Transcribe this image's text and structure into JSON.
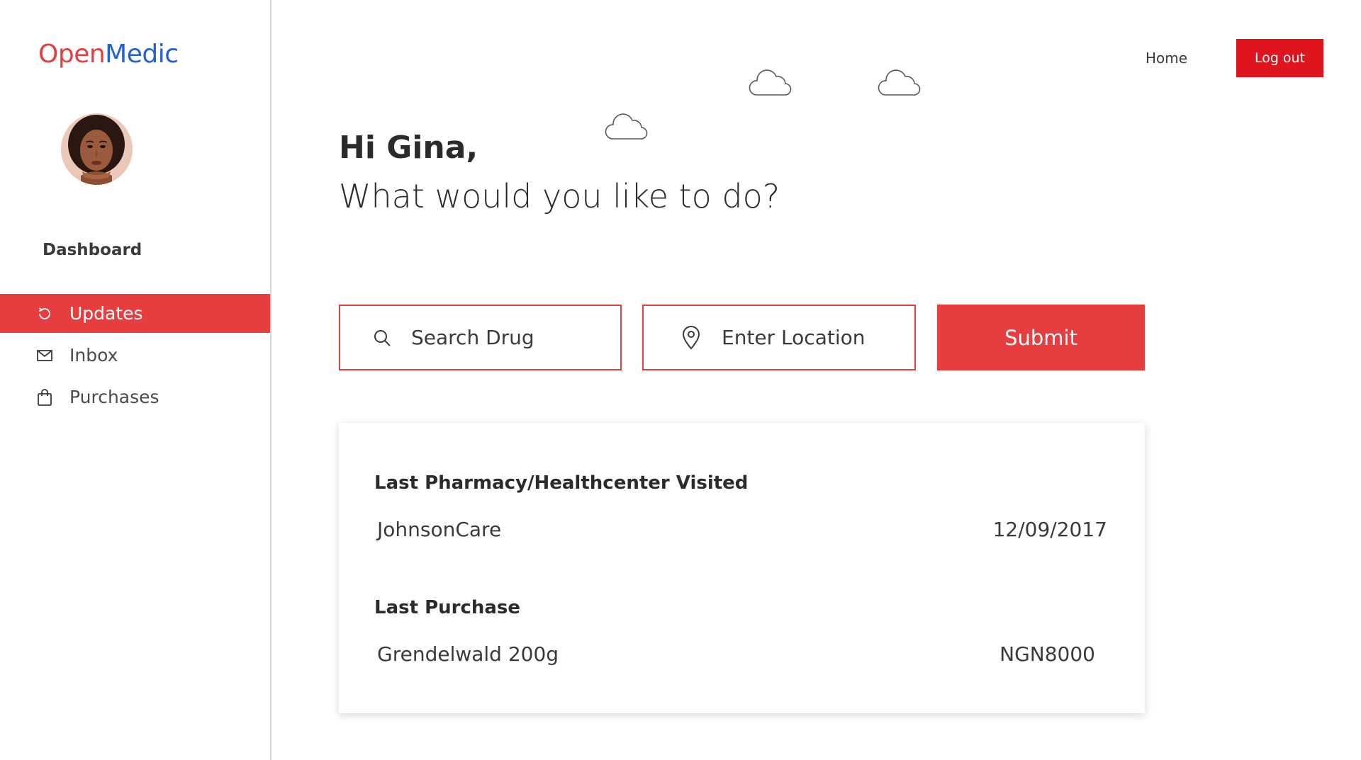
{
  "brand": {
    "part1": "Open",
    "part2": "Medic",
    "color1": "#e63d3f",
    "color2": "#2460d6"
  },
  "sidebar": {
    "heading": "Dashboard",
    "avatar": "user-avatar-photo",
    "items": [
      {
        "label": "Updates",
        "icon": "refresh-icon",
        "active": true
      },
      {
        "label": "Inbox",
        "icon": "mail-icon",
        "active": false
      },
      {
        "label": "Purchases",
        "icon": "shopping-bag-icon",
        "active": false
      }
    ]
  },
  "topnav": {
    "home_label": "Home",
    "logout_label": "Log out"
  },
  "greeting": {
    "title": "Hi Gina,",
    "subtitle": "What would you like to do?"
  },
  "search": {
    "drug_placeholder": "Search Drug",
    "location_placeholder": "Enter Location",
    "submit_label": "Submit"
  },
  "summary": {
    "last_visit_title": "Last Pharmacy/Healthcenter Visited",
    "last_visit_name": "JohnsonCare",
    "last_visit_date": "12/09/2017",
    "last_purchase_title": "Last Purchase",
    "last_purchase_item": "Grendelwald 200g",
    "last_purchase_amount": "NGN8000"
  },
  "colors": {
    "accent": "#e63d3f",
    "logout": "#e0141d",
    "text": "#2b2b2b"
  }
}
